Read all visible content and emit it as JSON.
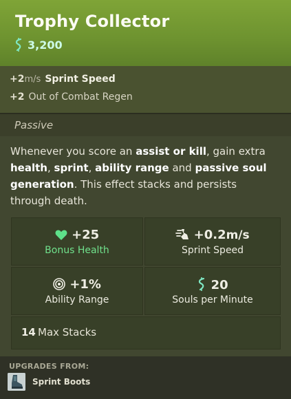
{
  "item": {
    "title": "Trophy Collector",
    "cost": "3,200",
    "colors": {
      "header": "#76a033",
      "soul": "#7fe8c4",
      "health": "#5ee08a"
    }
  },
  "properties": [
    {
      "value": "+2",
      "unit": "m/s",
      "label": "Sprint Speed"
    },
    {
      "value": "+2",
      "unit": "",
      "label": "Out of Combat Regen"
    }
  ],
  "passive": {
    "header": "Passive",
    "description": {
      "p1": "Whenever you score an ",
      "b1": "assist or kill",
      "p2": ", gain extra ",
      "b2": "health",
      "p3": ", ",
      "b3": "sprint",
      "p4": ", ",
      "b4": "ability range",
      "p5": " and ",
      "b5": "passive soul generation",
      "p6": ". This effect stacks and persists through death."
    }
  },
  "stats": {
    "health": {
      "icon": "heart-icon",
      "value": "+25",
      "unit": "",
      "label": "Bonus Health"
    },
    "sprint": {
      "icon": "sprint-icon",
      "value": "+0.2",
      "unit": "m/s",
      "label": "Sprint Speed"
    },
    "range": {
      "icon": "target-icon",
      "value": "+1",
      "unit": "%",
      "label": "Ability Range"
    },
    "souls": {
      "icon": "soul-icon",
      "value": "20",
      "unit": "",
      "label": "Souls per Minute"
    }
  },
  "stacks": {
    "value": "14",
    "label": "Max Stacks"
  },
  "upgrades": {
    "header": "UPGRADES FROM:",
    "items": [
      {
        "icon": "sprint-boots-icon",
        "name": "Sprint Boots"
      }
    ]
  }
}
